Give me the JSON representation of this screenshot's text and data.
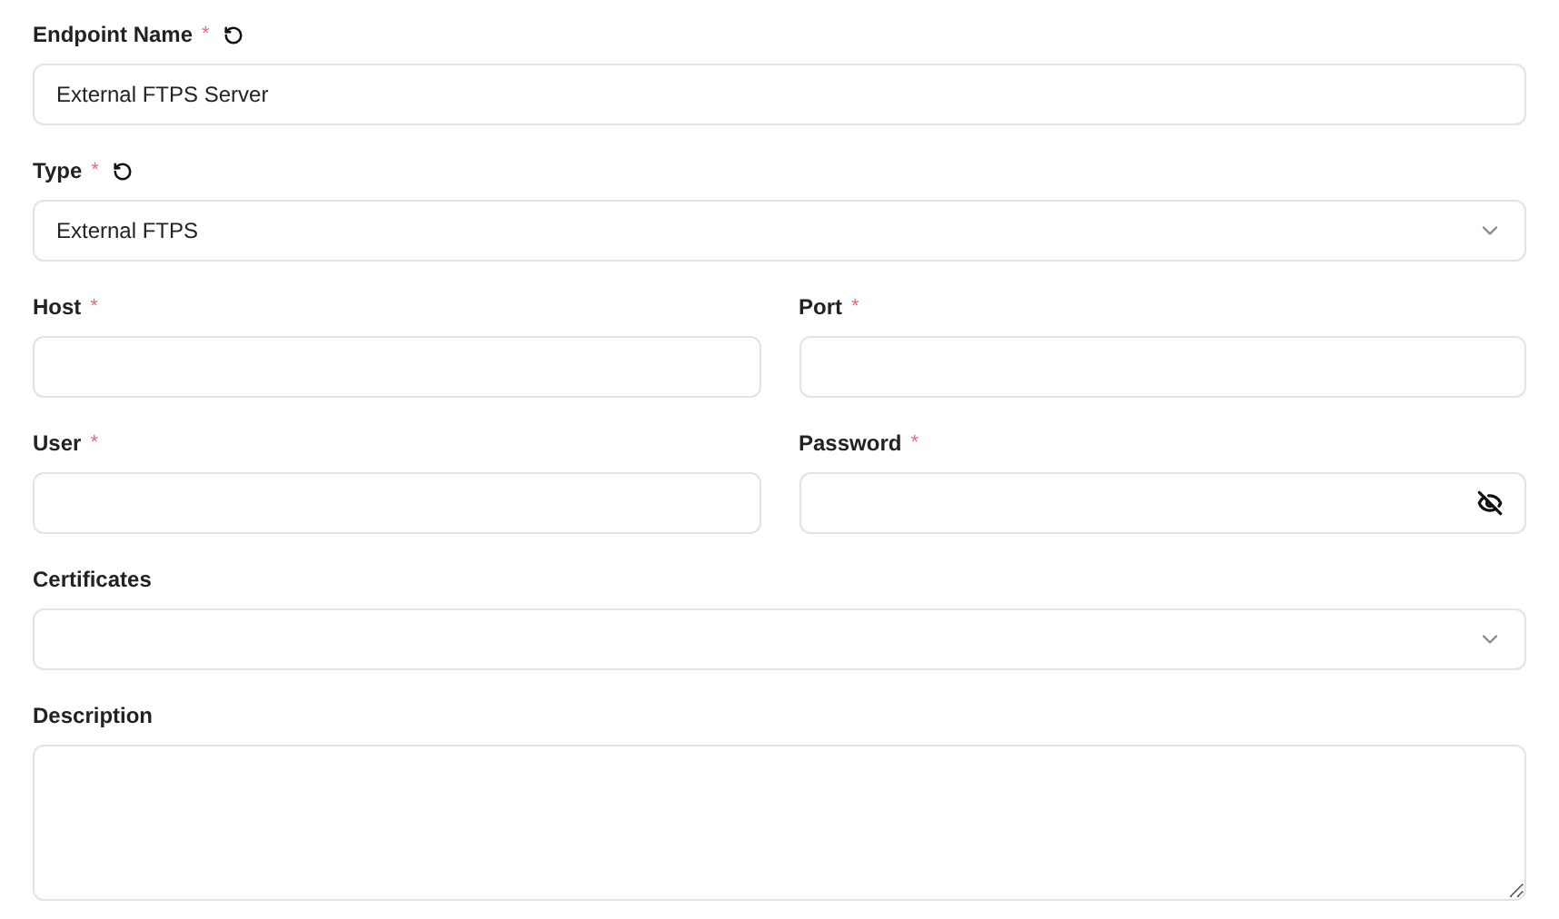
{
  "rows": [
    [
      {
        "label": "Endpoint Name",
        "required_mark": "*",
        "resettable": true,
        "kind": "text",
        "value": "External FTPS Server"
      }
    ],
    [
      {
        "label": "Type",
        "required_mark": "*",
        "resettable": true,
        "kind": "select",
        "value": "External FTPS"
      }
    ],
    [
      {
        "label": "Host",
        "required_mark": "*",
        "resettable": false,
        "kind": "text"
      },
      {
        "label": "Port",
        "required_mark": "*",
        "resettable": false,
        "kind": "text"
      }
    ],
    [
      {
        "label": "User",
        "required_mark": "*",
        "resettable": false,
        "kind": "text"
      },
      {
        "label": "Password",
        "required_mark": "*",
        "resettable": false,
        "kind": "password"
      }
    ],
    [
      {
        "label": "Certificates",
        "resettable": false,
        "kind": "select"
      }
    ],
    [
      {
        "label": "Description",
        "resettable": false,
        "kind": "textarea"
      }
    ]
  ]
}
